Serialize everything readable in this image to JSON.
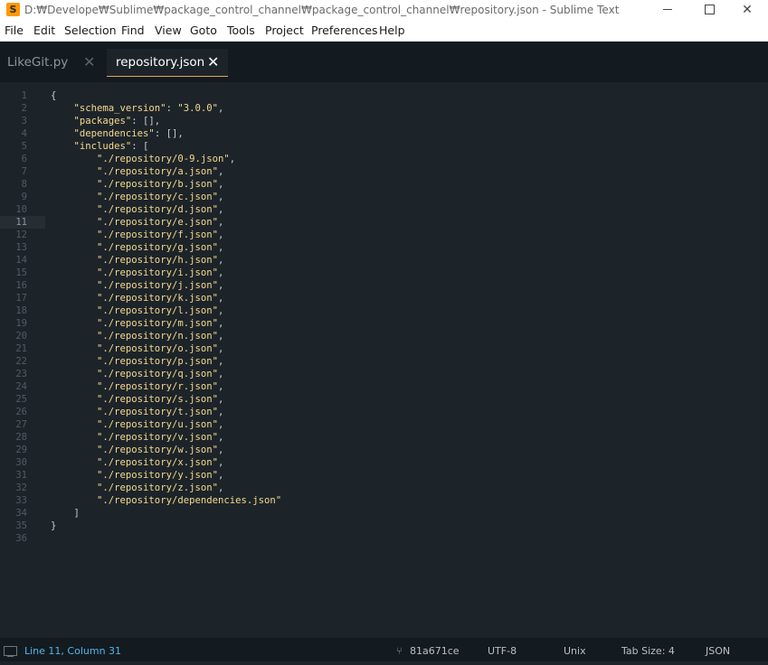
{
  "window": {
    "title": "D:₩Develope₩Sublime₩package_control_channel₩package_control_channel₩repository.json - Sublime Text"
  },
  "menu": [
    "File",
    "Edit",
    "Selection",
    "Find",
    "View",
    "Goto",
    "Tools",
    "Project",
    "Preferences",
    "Help"
  ],
  "tabs": [
    {
      "label": "LikeGit.py",
      "active": false
    },
    {
      "label": "repository.json",
      "active": true
    }
  ],
  "editor": {
    "current_line": 11,
    "line_numbers": [
      "1",
      "2",
      "3",
      "4",
      "5",
      "6",
      "7",
      "8",
      "9",
      "10",
      "11",
      "12",
      "13",
      "14",
      "15",
      "16",
      "17",
      "18",
      "19",
      "20",
      "21",
      "22",
      "23",
      "24",
      "25",
      "26",
      "27",
      "28",
      "29",
      "30",
      "31",
      "32",
      "33",
      "34",
      "35",
      "36"
    ],
    "lines": [
      "{",
      "    \"schema_version\": \"3.0.0\",",
      "    \"packages\": [],",
      "    \"dependencies\": [],",
      "    \"includes\": [",
      "        \"./repository/0-9.json\",",
      "        \"./repository/a.json\",",
      "        \"./repository/b.json\",",
      "        \"./repository/c.json\",",
      "        \"./repository/d.json\",",
      "        \"./repository/e.json\",",
      "        \"./repository/f.json\",",
      "        \"./repository/g.json\",",
      "        \"./repository/h.json\",",
      "        \"./repository/i.json\",",
      "        \"./repository/j.json\",",
      "        \"./repository/k.json\",",
      "        \"./repository/l.json\",",
      "        \"./repository/m.json\",",
      "        \"./repository/n.json\",",
      "        \"./repository/o.json\",",
      "        \"./repository/p.json\",",
      "        \"./repository/q.json\",",
      "        \"./repository/r.json\",",
      "        \"./repository/s.json\",",
      "        \"./repository/t.json\",",
      "        \"./repository/u.json\",",
      "        \"./repository/v.json\",",
      "        \"./repository/w.json\",",
      "        \"./repository/x.json\",",
      "        \"./repository/y.json\",",
      "        \"./repository/z.json\",",
      "        \"./repository/dependencies.json\"",
      "    ]",
      "}",
      ""
    ]
  },
  "status": {
    "position": "Line 11, Column 31",
    "git_commit": "81a671ce",
    "encoding": "UTF-8",
    "line_endings": "Unix",
    "tab_size": "Tab Size: 4",
    "syntax": "JSON"
  },
  "colors": {
    "background": "#1d2429",
    "string": "#f5d990",
    "accent": "#e2a54a",
    "status_position": "#55b4ea"
  },
  "icons": {
    "app": "sublime-text-icon",
    "close_tab": "close-icon",
    "git_branch": "git-branch-icon",
    "panel_toggle": "monitor-icon"
  }
}
